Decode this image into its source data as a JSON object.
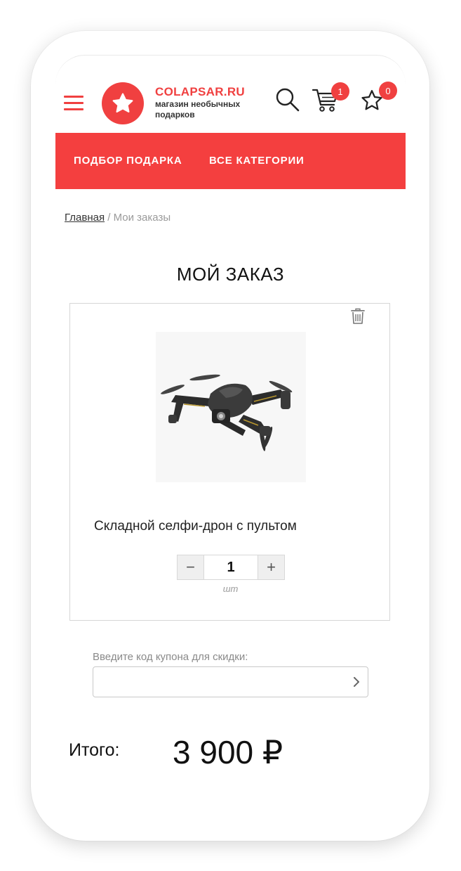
{
  "brand": {
    "name": "COLAPSAR.RU",
    "tagline": "магазин необычных подарков",
    "accent_color": "#f04040"
  },
  "header": {
    "menu_icon": "hamburger-menu-icon",
    "search_icon": "search-icon",
    "cart_icon": "cart-icon",
    "cart_count": "1",
    "favorites_icon": "star-outline-icon",
    "favorites_count": "0"
  },
  "nav": {
    "items": [
      {
        "label": "ПОДБОР ПОДАРКА"
      },
      {
        "label": "ВСЕ КАТЕГОРИИ"
      }
    ]
  },
  "breadcrumb": {
    "home": "Главная",
    "separator": "/",
    "current": "Мои заказы"
  },
  "page_title": "МОЙ ЗАКАЗ",
  "order_item": {
    "name": "Складной селфи-дрон с пультом",
    "image_icon": "drone-image",
    "delete_icon": "trash-icon",
    "quantity": "1",
    "unit": "шт",
    "minus": "−",
    "plus": "+"
  },
  "coupon": {
    "label": "Введите код купона для скидки:",
    "value": "",
    "submit_icon": "chevron-right-icon"
  },
  "total": {
    "label": "Итого:",
    "value": "3 900 ₽"
  }
}
